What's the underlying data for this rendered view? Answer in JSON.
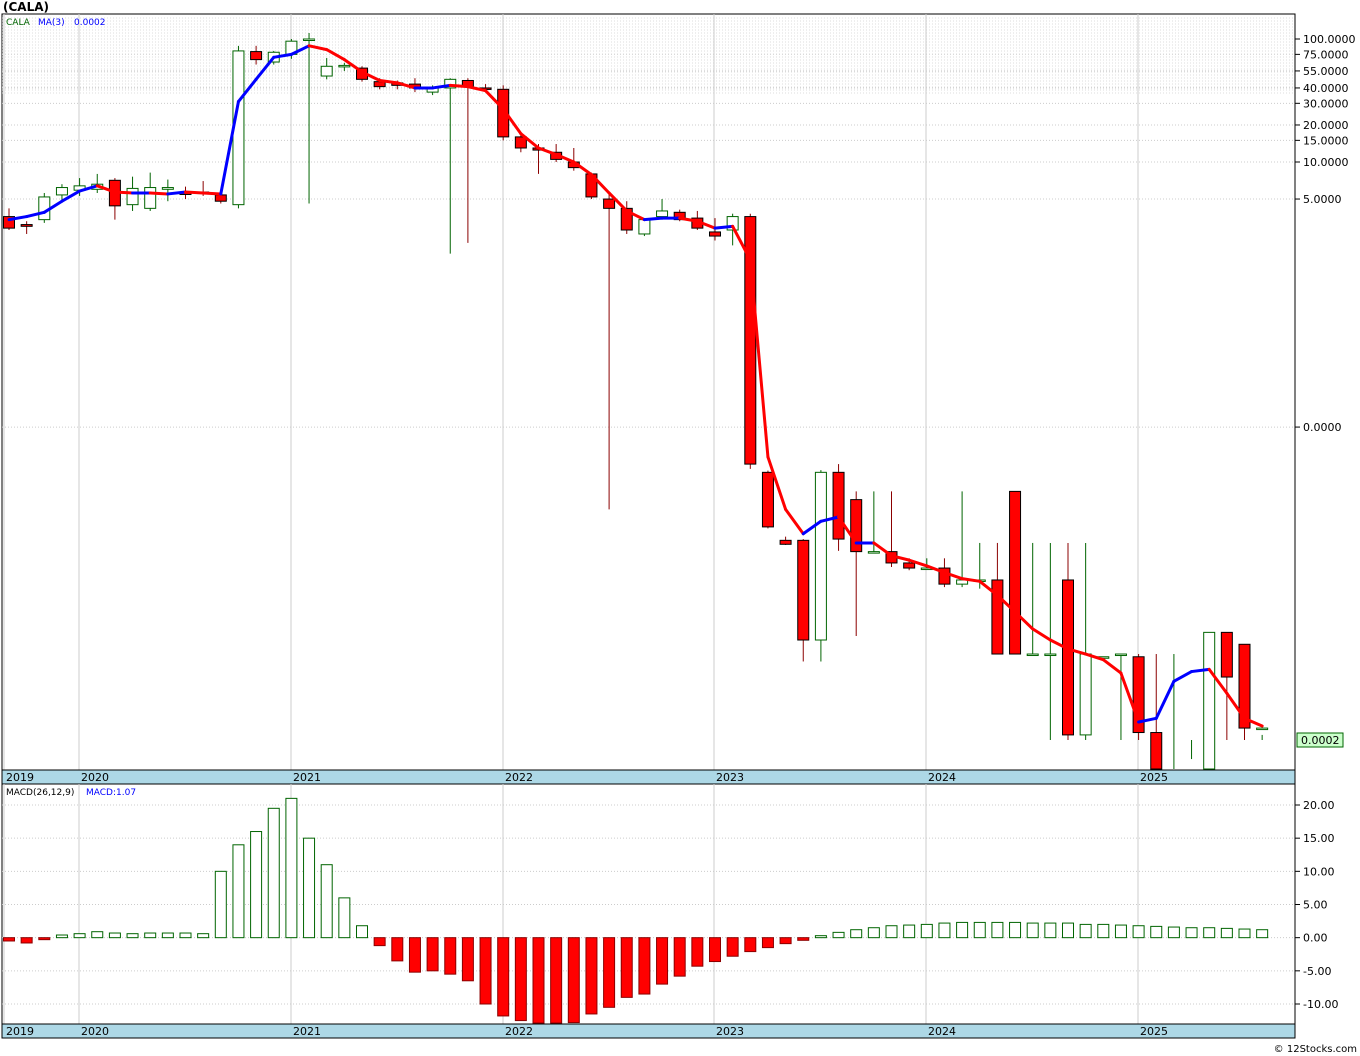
{
  "ticker_title": "(CALA)",
  "legend": {
    "symbol": "CALA",
    "ma_label": "MA(3)",
    "ma_value": "0.0002",
    "macd_label": "MACD(26,12,9)",
    "macd_value": "MACD:1.07"
  },
  "last_price_label": "0.0002",
  "copyright": "© 12Stocks.com",
  "year_labels": [
    "2019",
    "2020",
    "2021",
    "2022",
    "2023",
    "2024",
    "2025"
  ],
  "price_axis_labels": [
    "100.0000",
    "75.0000",
    "55.0000",
    "40.0000",
    "30.0000",
    "20.0000",
    "15.0000",
    "10.0000",
    "5.0000",
    "0.0000"
  ],
  "macd_axis_labels": [
    "20.00",
    "15.00",
    "10.00",
    "5.00",
    "0.00",
    "-5.00",
    "-10.00"
  ],
  "colors": {
    "up": "#006400",
    "down": "#ff0000",
    "ma_up": "#0000ff",
    "ma_down": "#ff0000",
    "axis_bg": "#add8e6",
    "grid": "#cccccc"
  },
  "chart_data": [
    {
      "type": "candlestick",
      "title": "(CALA)",
      "scale": "log",
      "x_start": "2019-11",
      "interval": "month",
      "ohlc": [
        [
          3.6,
          4.2,
          2.8,
          2.9
        ],
        [
          3.1,
          3.3,
          2.6,
          3.0
        ],
        [
          3.4,
          5.6,
          3.2,
          5.2
        ],
        [
          5.4,
          6.6,
          4.9,
          6.2
        ],
        [
          5.9,
          7.4,
          5.3,
          6.4
        ],
        [
          6.0,
          8.0,
          5.6,
          6.6
        ],
        [
          7.1,
          7.4,
          3.4,
          4.4
        ],
        [
          4.5,
          7.6,
          4.0,
          6.1
        ],
        [
          4.2,
          8.2,
          4.0,
          6.2
        ],
        [
          6.0,
          7.2,
          4.8,
          6.2
        ],
        [
          5.6,
          6.3,
          5.0,
          5.5
        ],
        [
          5.7,
          7.0,
          5.3,
          5.6
        ],
        [
          5.4,
          5.8,
          4.6,
          4.8
        ],
        [
          4.5,
          88.0,
          4.2,
          80.0
        ],
        [
          79.0,
          88.0,
          62.0,
          68.0
        ],
        [
          65.0,
          80.0,
          62.0,
          78.0
        ],
        [
          75.0,
          100.0,
          69.0,
          96.0
        ],
        [
          98.0,
          112.0,
          4.6,
          100.0
        ],
        [
          50.0,
          70.0,
          47.0,
          60.0
        ],
        [
          60.0,
          64.0,
          55.0,
          61.0
        ],
        [
          58.0,
          60.0,
          45.0,
          47.0
        ],
        [
          45.0,
          48.0,
          39.0,
          41.0
        ],
        [
          44.0,
          46.0,
          39.0,
          42.0
        ],
        [
          43.0,
          48.0,
          37.0,
          40.0
        ],
        [
          37.0,
          42.0,
          35.0,
          40.0
        ],
        [
          40.0,
          48.0,
          1.8,
          47.0
        ],
        [
          46.0,
          48.0,
          2.2,
          41.0
        ],
        [
          40.0,
          43.0,
          38.0,
          39.0
        ],
        [
          39.0,
          42.0,
          15.0,
          16.0
        ],
        [
          16.0,
          17.0,
          12.0,
          13.0
        ],
        [
          13.0,
          14.0,
          8.0,
          12.5
        ],
        [
          12.0,
          14.0,
          10.0,
          10.5
        ],
        [
          10.0,
          13.0,
          8.5,
          9.0
        ],
        [
          8.0,
          8.2,
          5.0,
          5.2
        ],
        [
          5.0,
          5.5,
          0.015,
          4.2
        ],
        [
          4.2,
          4.8,
          2.6,
          2.8
        ],
        [
          2.6,
          3.4,
          2.5,
          3.4
        ],
        [
          3.6,
          5.0,
          3.4,
          4.0
        ],
        [
          3.9,
          4.1,
          3.3,
          3.4
        ],
        [
          3.5,
          4.0,
          2.8,
          2.9
        ],
        [
          2.7,
          3.5,
          2.3,
          2.5
        ],
        [
          2.8,
          3.8,
          2.1,
          3.6
        ],
        [
          3.6,
          3.8,
          0.032,
          0.035
        ],
        [
          0.03,
          0.031,
          0.0105,
          0.0108
        ],
        [
          0.0084,
          0.009,
          0.0077,
          0.0078
        ],
        [
          0.0084,
          0.0086,
          0.00087,
          0.0013
        ],
        [
          0.0013,
          0.0313,
          0.00087,
          0.03
        ],
        [
          0.03,
          0.035,
          0.0069,
          0.0086
        ],
        [
          0.018,
          0.021,
          0.0014,
          0.0068
        ],
        [
          0.0068,
          0.021,
          0.0068,
          0.0068
        ],
        [
          0.0068,
          0.021,
          0.0051,
          0.0055
        ],
        [
          0.0055,
          0.006,
          0.0048,
          0.005
        ],
        [
          0.005,
          0.006,
          0.005,
          0.005
        ],
        [
          0.005,
          0.006,
          0.0035,
          0.0037
        ],
        [
          0.0037,
          0.021,
          0.0035,
          0.004
        ],
        [
          0.004,
          0.008,
          0.0034,
          0.004
        ],
        [
          0.004,
          0.008,
          0.001,
          0.001
        ],
        [
          0.021,
          0.021,
          0.001,
          0.001
        ],
        [
          0.001,
          0.008,
          0.001,
          0.001
        ],
        [
          0.001,
          0.008,
          0.0002,
          0.001
        ],
        [
          0.004,
          0.008,
          0.0002,
          0.00022
        ],
        [
          0.00022,
          0.008,
          0.0002,
          0.001
        ],
        [
          0.00095,
          0.001,
          0.001,
          0.00095
        ],
        [
          0.001,
          0.001,
          0.0002,
          0.001
        ],
        [
          0.00095,
          0.001,
          0.0002,
          0.00023
        ],
        [
          0.00023,
          0.001,
          0.0002,
          8e-05
        ],
        [
          8e-05,
          0.001,
          8e-05,
          0.0001
        ],
        [
          0.0001,
          0.00014,
          0.0002,
          0.0001
        ],
        [
          0.0001,
          0.0015,
          0.0002,
          0.0015
        ],
        [
          0.0015,
          0.0015,
          0.0002,
          0.00065
        ],
        [
          0.0012,
          0.0012,
          0.0002,
          0.00025
        ],
        [
          0.00025,
          0.00022,
          0.0002,
          0.00025
        ]
      ],
      "ma3": [
        3.4,
        3.6,
        3.9,
        4.8,
        5.8,
        6.4,
        5.7,
        5.6,
        5.6,
        5.5,
        5.7,
        5.6,
        5.5,
        31.0,
        47.0,
        71.0,
        75.0,
        88.0,
        82.0,
        68.0,
        54.0,
        46.0,
        44.0,
        40.0,
        40.0,
        42.0,
        41.0,
        38.0,
        27.0,
        17.0,
        13.0,
        11.5,
        10.0,
        7.9,
        5.6,
        4.0,
        3.4,
        3.5,
        3.5,
        3.3,
        2.9,
        3.0,
        1.6,
        0.04,
        0.015,
        0.0095,
        0.012,
        0.013,
        0.008,
        0.008,
        0.0063,
        0.0058,
        0.0052,
        0.0046,
        0.0041,
        0.0039,
        0.003,
        0.0022,
        0.0016,
        0.0013,
        0.0011,
        0.001,
        0.0009,
        0.0007,
        0.00028,
        0.0003,
        0.0006,
        0.00072,
        0.00075,
        0.00048,
        0.0003,
        0.00026
      ],
      "x_labels": [
        "2019",
        "2020",
        "2021",
        "2022",
        "2023",
        "2024",
        "2025"
      ],
      "y_tick_labels": [
        "100.0000",
        "75.0000",
        "55.0000",
        "40.0000",
        "30.0000",
        "20.0000",
        "15.0000",
        "10.0000",
        "5.0000",
        "0.0000"
      ],
      "y_axis_side": "right",
      "grid": true,
      "last_value_label": "0.0002"
    },
    {
      "type": "bar",
      "title": "MACD(26,12,9)",
      "series": [
        {
          "name": "MACD:1.07",
          "values": [
            -0.5,
            -0.8,
            -0.3,
            0.4,
            0.6,
            0.9,
            0.7,
            0.6,
            0.7,
            0.7,
            0.7,
            0.6,
            10.0,
            14.0,
            16.0,
            19.5,
            21.0,
            15.0,
            11.0,
            6.0,
            1.8,
            -1.2,
            -3.5,
            -5.2,
            -5.0,
            -5.5,
            -6.5,
            -10.0,
            -11.8,
            -12.5,
            -13.0,
            -13.0,
            -12.8,
            -11.5,
            -10.5,
            -9.0,
            -8.5,
            -7.0,
            -5.8,
            -4.3,
            -3.6,
            -2.8,
            -2.1,
            -1.5,
            -0.9,
            -0.4,
            0.3,
            0.8,
            1.2,
            1.5,
            1.8,
            1.9,
            2.0,
            2.2,
            2.3,
            2.3,
            2.3,
            2.3,
            2.2,
            2.2,
            2.2,
            2.0,
            2.0,
            1.9,
            1.8,
            1.7,
            1.6,
            1.5,
            1.5,
            1.4,
            1.3,
            1.2
          ]
        }
      ],
      "x_start": "2019-11",
      "interval": "month",
      "ylim": [
        -13,
        21
      ],
      "y_tick_labels": [
        "20.00",
        "15.00",
        "10.00",
        "5.00",
        "0.00",
        "-5.00",
        "-10.00"
      ],
      "x_labels": [
        "2019",
        "2020",
        "2021",
        "2022",
        "2023",
        "2024",
        "2025"
      ],
      "grid": true
    }
  ]
}
